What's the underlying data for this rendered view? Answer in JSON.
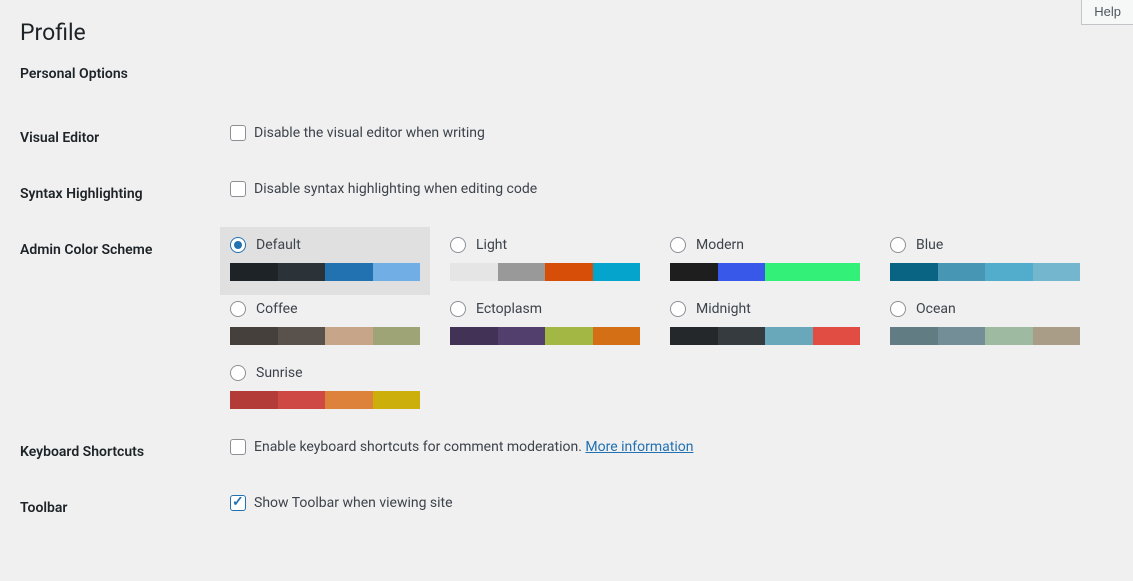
{
  "help_label": "Help",
  "page_title": "Profile",
  "section_title": "Personal Options",
  "rows": {
    "visual_editor": {
      "label": "Visual Editor",
      "checkbox_label": "Disable the visual editor when writing"
    },
    "syntax_highlighting": {
      "label": "Syntax Highlighting",
      "checkbox_label": "Disable syntax highlighting when editing code"
    },
    "color_scheme": {
      "label": "Admin Color Scheme"
    },
    "keyboard_shortcuts": {
      "label": "Keyboard Shortcuts",
      "checkbox_label": "Enable keyboard shortcuts for comment moderation. ",
      "link_text": "More information"
    },
    "toolbar": {
      "label": "Toolbar",
      "checkbox_label": "Show Toolbar when viewing site"
    }
  },
  "color_schemes": [
    {
      "name": "Default",
      "selected": true,
      "colors": [
        "#1d2327",
        "#2c3338",
        "#2271b1",
        "#72aee6"
      ]
    },
    {
      "name": "Light",
      "selected": false,
      "colors": [
        "#e5e5e5",
        "#999999",
        "#d64e07",
        "#04a4cc"
      ]
    },
    {
      "name": "Modern",
      "selected": false,
      "colors": [
        "#1e1e1e",
        "#3858e9",
        "#33f078",
        "#33f078"
      ]
    },
    {
      "name": "Blue",
      "selected": false,
      "colors": [
        "#096484",
        "#4796b3",
        "#52accc",
        "#74b6ce"
      ]
    },
    {
      "name": "Coffee",
      "selected": false,
      "colors": [
        "#46403c",
        "#59524c",
        "#c7a589",
        "#9ea476"
      ]
    },
    {
      "name": "Ectoplasm",
      "selected": false,
      "colors": [
        "#413256",
        "#523f6d",
        "#a3b745",
        "#d46f15"
      ]
    },
    {
      "name": "Midnight",
      "selected": false,
      "colors": [
        "#25282b",
        "#363b3f",
        "#69a8bb",
        "#e14d43"
      ]
    },
    {
      "name": "Ocean",
      "selected": false,
      "colors": [
        "#627c83",
        "#738e96",
        "#9ebaa0",
        "#aa9d88"
      ]
    },
    {
      "name": "Sunrise",
      "selected": false,
      "colors": [
        "#b43c38",
        "#cf4944",
        "#dd823b",
        "#ccaf0b"
      ]
    }
  ]
}
